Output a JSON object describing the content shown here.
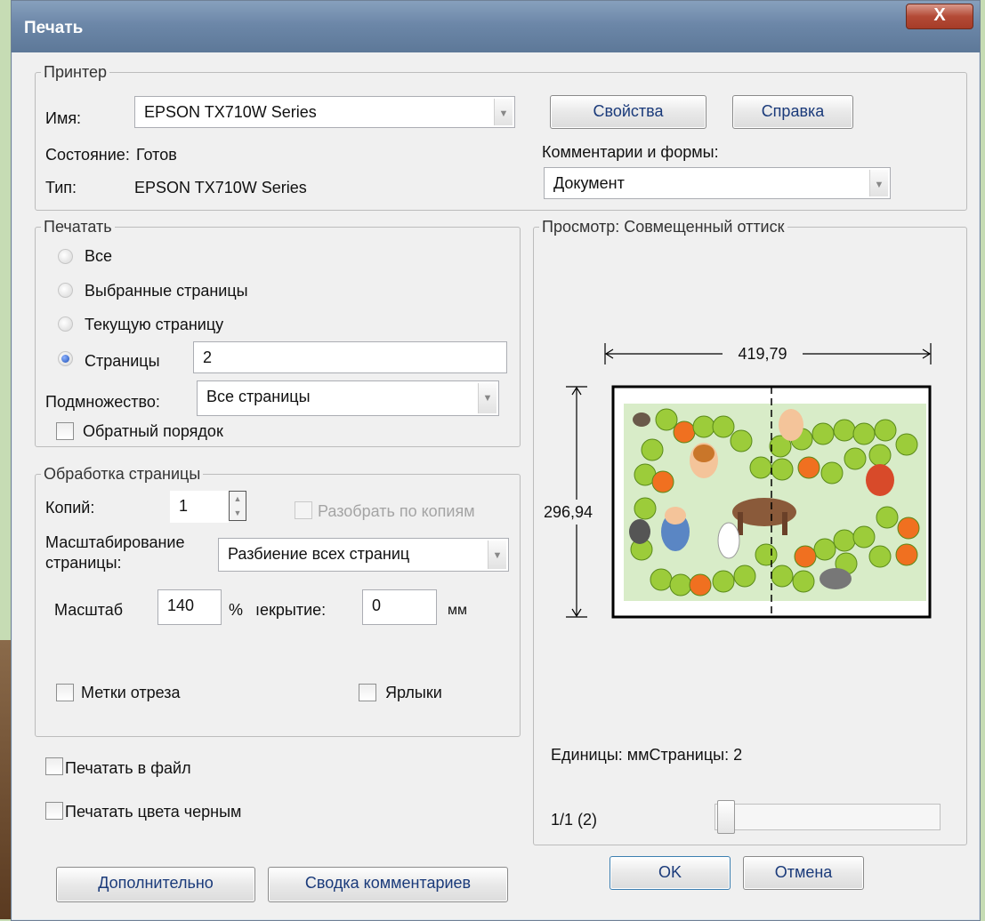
{
  "window": {
    "title": "Печать",
    "close_glyph": "X"
  },
  "printer": {
    "legend": "Принтер",
    "name_label": "Имя:",
    "name_value": "EPSON TX710W Series",
    "status_label": "Состояние:",
    "status_value": "Готов",
    "type_label": "Тип:",
    "type_value": "EPSON TX710W Series",
    "properties_button": "Свойства",
    "help_button": "Справка",
    "comments_label": "Комментарии и формы:",
    "comments_value": "Документ"
  },
  "print_range": {
    "legend": "Печатать",
    "options": [
      "Все",
      "Выбранные страницы",
      "Текущую страницу",
      "Страницы"
    ],
    "selected": "Страницы",
    "pages_value": "2",
    "subset_label": "Подмножество:",
    "subset_value": "Все страницы",
    "reverse_label": "Обратный порядок",
    "reverse_checked": false
  },
  "page_handling": {
    "legend": "Обработка страницы",
    "copies_label": "Копий:",
    "copies_value": "1",
    "collate_label": "Разобрать по копиям",
    "collate_enabled": false,
    "scaling_label_1": "Масштабирование",
    "scaling_label_2": "страницы:",
    "scaling_value": "Разбиение всех страниц",
    "scale_label": "Масштаб",
    "scale_value": "140",
    "scale_unit": "%",
    "overlap_label": "ıекрытие:",
    "overlap_value": "0",
    "overlap_unit": "мм",
    "cut_marks_label": "Метки отреза",
    "labels_label": "Ярлыки"
  },
  "options": {
    "print_to_file": "Печатать в файл",
    "print_black": "Печатать цвета черным"
  },
  "preview": {
    "legend": "Просмотр: Совмещенный оттиск",
    "width_value": "419,79",
    "height_value": "296,94",
    "units_text": "Единицы: ммСтраницы: 2",
    "page_indicator": "1/1 (2)",
    "slider_position": 0
  },
  "buttons": {
    "advanced": "Дополнительно",
    "summarize": "Сводка комментариев",
    "ok": "OK",
    "cancel": "Отмена"
  },
  "colors": {
    "titlebar": "#6c87a8",
    "close": "#b34a36",
    "game_green": "#9ccc3a",
    "game_orange": "#f07020",
    "board_bg": "#d8ecc8"
  }
}
